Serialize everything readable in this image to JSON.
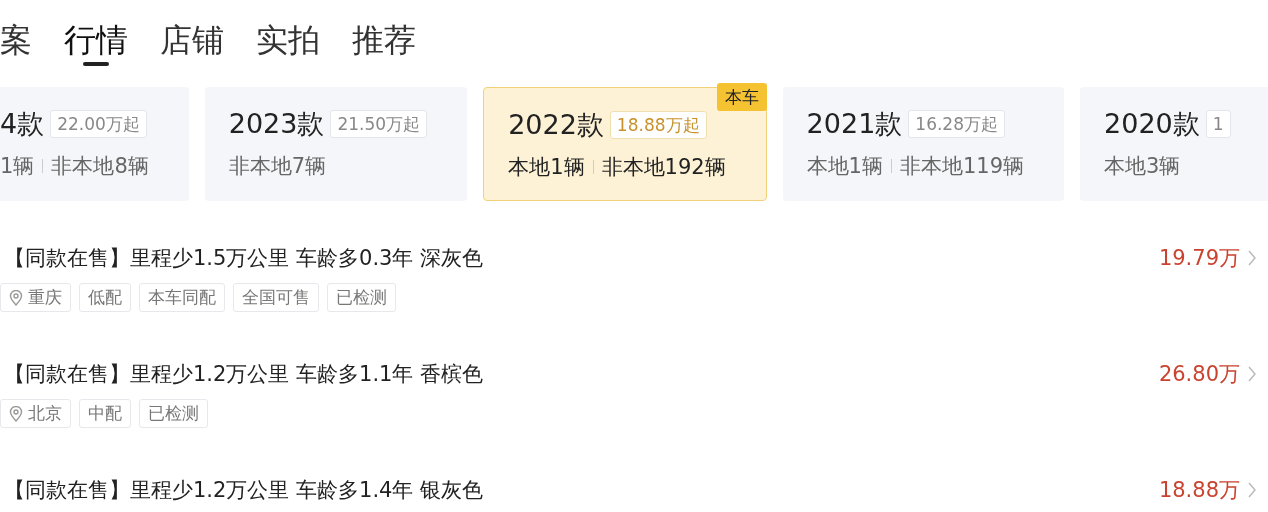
{
  "tabs": [
    {
      "label": "案",
      "selected": false
    },
    {
      "label": "行情",
      "selected": true
    },
    {
      "label": "店铺",
      "selected": false
    },
    {
      "label": "实拍",
      "selected": false
    },
    {
      "label": "推荐",
      "selected": false
    }
  ],
  "model_years": [
    {
      "year": "4款",
      "price": "22.00万起",
      "local": "1辆",
      "nonlocal": "非本地8辆",
      "selected": false
    },
    {
      "year": "2023款",
      "price": "21.50万起",
      "nonlocal": "非本地7辆",
      "selected": false
    },
    {
      "year": "2022款",
      "price": "18.88万起",
      "local": "本地1辆",
      "nonlocal": "非本地192辆",
      "selected": true,
      "badge": "本车"
    },
    {
      "year": "2021款",
      "price": "16.28万起",
      "local": "本地1辆",
      "nonlocal": "非本地119辆",
      "selected": false
    },
    {
      "year": "2020款",
      "price": "1",
      "local": "本地3辆",
      "selected": false
    }
  ],
  "listings": [
    {
      "title": "【同款在售】里程少1.5万公里 车龄多0.3年 深灰色",
      "price": "19.79万",
      "tags": [
        {
          "kind": "location",
          "label": "重庆"
        },
        {
          "kind": "plain",
          "label": "低配"
        },
        {
          "kind": "plain",
          "label": "本车同配"
        },
        {
          "kind": "plain",
          "label": "全国可售"
        },
        {
          "kind": "plain",
          "label": "已检测"
        }
      ]
    },
    {
      "title": "【同款在售】里程少1.2万公里 车龄多1.1年 香槟色",
      "price": "26.80万",
      "tags": [
        {
          "kind": "location",
          "label": "北京"
        },
        {
          "kind": "plain",
          "label": "中配"
        },
        {
          "kind": "plain",
          "label": "已检测"
        }
      ]
    },
    {
      "title": "【同款在售】里程少1.2万公里 车龄多1.4年 银灰色",
      "price": "18.88万"
    }
  ]
}
